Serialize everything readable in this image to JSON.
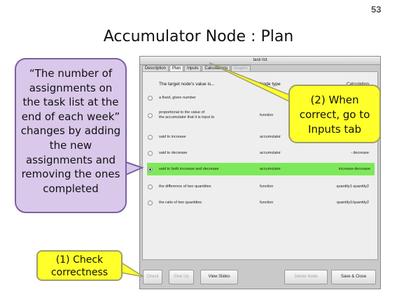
{
  "slide_number": "53",
  "slide_title": "Accumulator Node : Plan",
  "window": {
    "title": "task list",
    "tabs": [
      {
        "label": "Description",
        "state": "normal"
      },
      {
        "label": "Plan",
        "state": "active"
      },
      {
        "label": "Inputs",
        "state": "normal"
      },
      {
        "label": "Calculations",
        "state": "normal"
      },
      {
        "label": "Graphs",
        "state": "disabled"
      }
    ],
    "columns": {
      "value": "The target node's value is...",
      "type": "Node type",
      "calc": "Calculation"
    },
    "rows": [
      {
        "value": "a fixed, given number",
        "value2": "",
        "type": "",
        "calc": "",
        "selected": false
      },
      {
        "value": "proportional to the value of",
        "value2": "the accumulator that it is input to",
        "type": "function",
        "calc": "",
        "selected": false
      },
      {
        "value": "said to increase",
        "value2": "",
        "type": "accumulator",
        "calc": "",
        "selected": false
      },
      {
        "value": "said to decrease",
        "value2": "",
        "type": "accumulator",
        "calc": "- decrease",
        "selected": false
      },
      {
        "value": "said to both increase and decrease",
        "value2": "",
        "type": "accumulator",
        "calc": "increase-decrease",
        "selected": true
      },
      {
        "value": "the difference of two quantities",
        "value2": "",
        "type": "function",
        "calc": "quantity1-quantity2",
        "selected": false
      },
      {
        "value": "the ratio of two quantities",
        "value2": "",
        "type": "function",
        "calc": "quantity1/quantity2",
        "selected": false
      }
    ],
    "buttons": {
      "check": "Check",
      "give_up": "Give Up",
      "view_slides": "View Slides",
      "delete_node": "Delete Node",
      "save_close": "Save & Close"
    }
  },
  "callouts": {
    "description": "“The number of assignments on the task list at the end of each week” changes by adding the new assignments and removing the ones completed",
    "step2": "(2) When correct, go to Inputs tab",
    "step1": "(1) Check correctness"
  },
  "colors": {
    "selected_row": "#7de95a",
    "callout_yellow": "#ffff2a",
    "callout_purple": "#d9c8ea"
  }
}
